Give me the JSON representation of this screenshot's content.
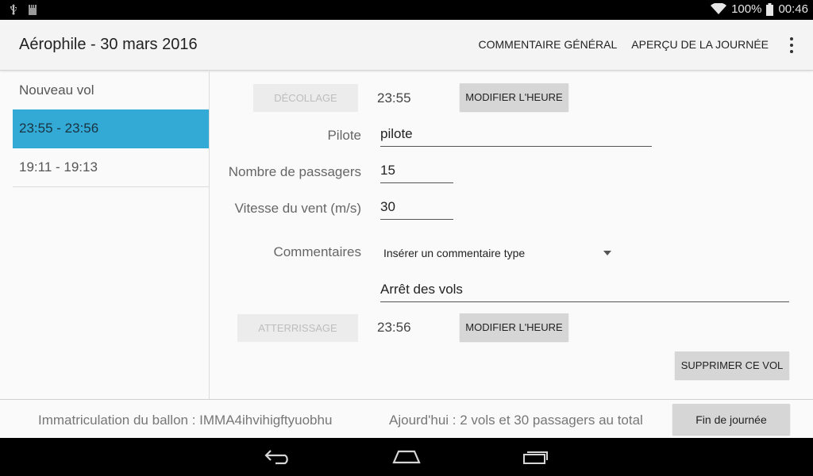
{
  "status_bar": {
    "battery": "100%",
    "time": "00:46"
  },
  "app_bar": {
    "title": "Aérophile - 30 mars 2016",
    "actions": [
      "COMMENTAIRE GÉNÉRAL",
      "APERÇU DE LA JOURNÉE"
    ]
  },
  "sidebar": {
    "items": [
      {
        "label": "Nouveau vol"
      },
      {
        "label": "23:55 - 23:56"
      },
      {
        "label": "19:11 - 19:13"
      }
    ]
  },
  "flight": {
    "takeoff_label": "DÉCOLLAGE",
    "takeoff_time": "23:55",
    "modify_time_label": "MODIFIER L'HEURE",
    "pilot_label": "Pilote",
    "pilot_value": "pilote",
    "passengers_label": "Nombre de passagers",
    "passengers_value": "15",
    "wind_label": "Vitesse du vent (m/s)",
    "wind_value": "30",
    "comments_label": "Commentaires",
    "comment_type_placeholder": "Insérer un commentaire type",
    "comment_value": "Arrêt des vols",
    "landing_label": "ATTERRISSAGE",
    "landing_time": "23:56",
    "delete_label": "SUPPRIMER CE VOL"
  },
  "footer": {
    "registration": "Immatriculation du ballon : IMMA4ihvihigftyuobhu",
    "summary": "Ajourd'hui : 2 vols et 30 passagers au total",
    "end_day_label": "Fin de journée"
  },
  "colors": {
    "selected": "#33a9d6"
  }
}
